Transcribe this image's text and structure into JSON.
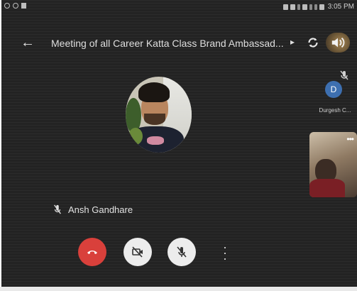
{
  "status_bar": {
    "time": "3:05 PM"
  },
  "header": {
    "meeting_title": "Meeting of all Career Katta Class Brand Ambassad..."
  },
  "participants": [
    {
      "initial": "D",
      "name": "Durgesh C...",
      "muted": true
    }
  ],
  "active_speaker": {
    "name": "Ansh Gandhare",
    "muted": true
  },
  "controls": {
    "end_call_color": "#d9403b",
    "button_color": "#ececec"
  },
  "icons": [
    "back-icon",
    "more-arrow-icon",
    "camera-switch-icon",
    "volume-icon",
    "mic-off-icon",
    "end-call-icon",
    "camera-off-icon",
    "more-options-icon"
  ]
}
